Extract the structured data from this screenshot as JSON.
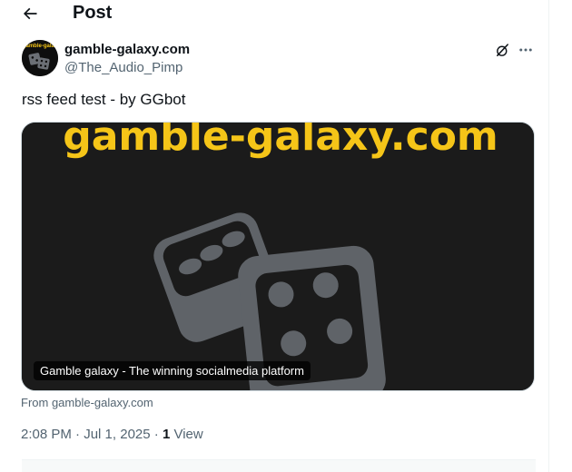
{
  "header": {
    "title": "Post",
    "back_icon": "arrow-left-icon"
  },
  "post": {
    "author": {
      "name": "gamble-galaxy.com",
      "handle": "@The_Audio_Pimp",
      "avatar_text": "gamble-galax"
    },
    "text": "rss feed test - by GGbot",
    "card": {
      "headline": "gamble-galaxy.com",
      "caption": "Gamble galaxy - The winning socialmedia platform",
      "source": "From gamble-galaxy.com",
      "image_icon": "dice-icon"
    },
    "meta": {
      "time": "2:08 PM",
      "separator": "·",
      "date": "Jul 1, 2025",
      "views_count": "1",
      "views_label": "View"
    }
  },
  "colors": {
    "text_primary": "#0f1419",
    "text_secondary": "#536471",
    "border": "#cfd9de",
    "card_background": "#1b1b1b",
    "headline_yellow": "#f5c518",
    "dice_gray": "#5f6368"
  },
  "icons": {
    "grok": "grok-icon",
    "more": "more-dots-icon"
  }
}
